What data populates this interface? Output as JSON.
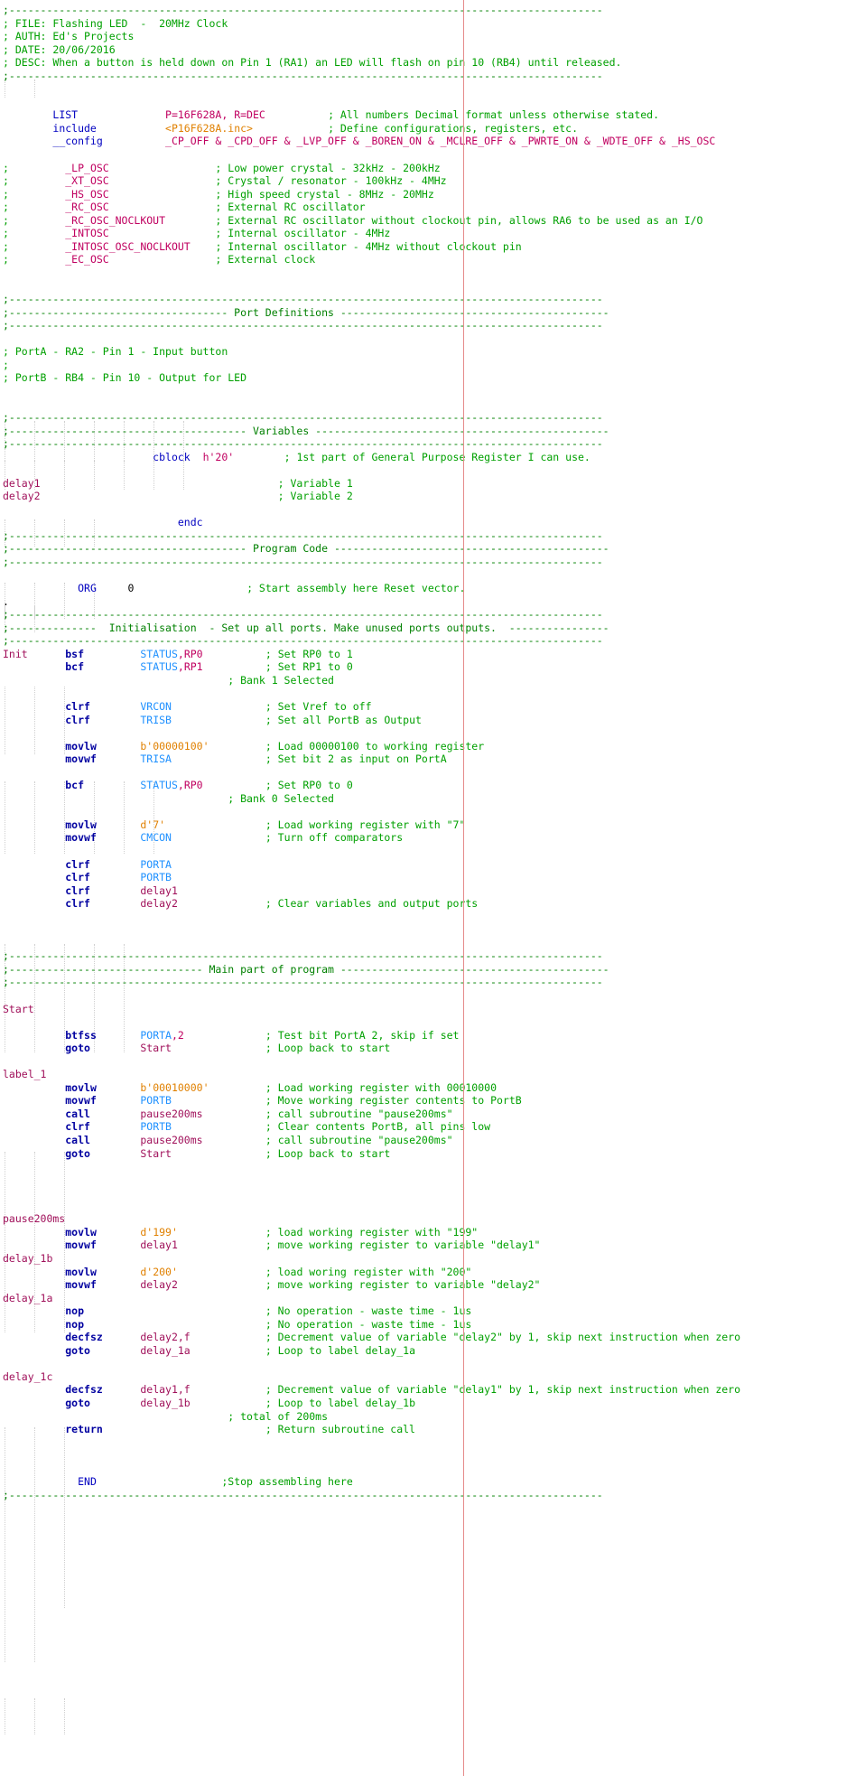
{
  "document": {
    "kind": "assembly-source",
    "language": "PIC Assembly (MPASM)",
    "file_header": {
      "file": "; FILE: Flashing LED  -  20MHz Clock",
      "auth": "; AUTH: Ed's Projects",
      "date": "; DATE: 20/06/2016",
      "desc": "; DESC: When a button is held down on Pin 1 (RA1) an LED will flash on pin 10 (RB4) until released."
    },
    "colors": {
      "background": "#ffffff",
      "comment": "#00a000",
      "directive": "#0000c0",
      "mnemonic": "#0000a0",
      "register": "#1e90ff",
      "label": "#a0105a",
      "literal": "#e08000",
      "margin_guide": "#e58b8b",
      "indent_guide": "#cfcfcf"
    },
    "margin_guide_column_x": 513,
    "separators": {
      "plain": ";-----------------------------------------------------------------------------------------------",
      "port_definitions": ";----------------------------------- Port Definitions -----------------------------------",
      "variables": ";-------------------------------------- Variables ---------------------------------------",
      "program_code": ";-------------------------------------- Program Code ------------------------------------",
      "initialisation": ";-------------- Initialisation  - Set up all ports. Make unused ports outputs.  ------------",
      "main_part": ";------------------------------- Main part of program ------------------------------------"
    },
    "lines": [
      {
        "i": 0,
        "type": "sep",
        "text": ";-----------------------------------------------------------------------------------------------"
      },
      {
        "i": 1,
        "type": "comment",
        "text": "; FILE: Flashing LED  -  20MHz Clock"
      },
      {
        "i": 2,
        "type": "comment",
        "text": "; AUTH: Ed's Projects"
      },
      {
        "i": 3,
        "type": "comment",
        "text": "; DATE: 20/06/2016"
      },
      {
        "i": 4,
        "type": "comment",
        "text": "; DESC: When a button is held down on Pin 1 (RA1) an LED will flash on pin 10 (RB4) until released."
      },
      {
        "i": 5,
        "type": "sep",
        "text": ";-----------------------------------------------------------------------------------------------"
      },
      {
        "i": 6,
        "type": "blank",
        "text": ""
      },
      {
        "i": 7,
        "type": "blank",
        "text": ""
      },
      {
        "i": 8,
        "type": "code",
        "label": "",
        "mnemonic": "LIST",
        "operand": "P=16F628A, R=DEC",
        "comment": "; All numbers Decimal format unless otherwise stated."
      },
      {
        "i": 9,
        "type": "code",
        "label": "",
        "mnemonic": "include",
        "operand": "<P16F628A.inc>",
        "comment": "; Define configurations, registers, etc."
      },
      {
        "i": 10,
        "type": "code",
        "label": "",
        "mnemonic": "__config",
        "operand": "_CP_OFF & _CPD_OFF & _LVP_OFF & _BOREN_ON & _MCLRE_OFF & _PWRTE_ON & _WDTE_OFF & _HS_OSC",
        "comment": ""
      },
      {
        "i": 11,
        "type": "blank",
        "text": ""
      },
      {
        "i": 12,
        "type": "osc",
        "symbol": "_LP_OSC",
        "comment": "; Low power crystal - 32kHz - 200kHz"
      },
      {
        "i": 13,
        "type": "osc",
        "symbol": "_XT_OSC",
        "comment": "; Crystal / resonator - 100kHz - 4MHz"
      },
      {
        "i": 14,
        "type": "osc",
        "symbol": "_HS_OSC",
        "comment": "; High speed crystal - 8MHz - 20MHz"
      },
      {
        "i": 15,
        "type": "osc",
        "symbol": "_RC_OSC",
        "comment": "; External RC oscillator"
      },
      {
        "i": 16,
        "type": "osc",
        "symbol": "_RC_OSC_NOCLKOUT",
        "comment": "; External RC oscillator without clockout pin, allows RA6 to be used as an I/O"
      },
      {
        "i": 17,
        "type": "osc",
        "symbol": "_INTOSC",
        "comment": "; Internal oscillator - 4MHz"
      },
      {
        "i": 18,
        "type": "osc",
        "symbol": "_INTOSC_OSC_NOCLKOUT",
        "comment": "; Internal oscillator - 4MHz without clockout pin"
      },
      {
        "i": 19,
        "type": "osc",
        "symbol": "_EC_OSC",
        "comment": "; External clock"
      },
      {
        "i": 20,
        "type": "blank",
        "text": ""
      },
      {
        "i": 21,
        "type": "blank",
        "text": ""
      },
      {
        "i": 22,
        "type": "sep",
        "text": ";-----------------------------------------------------------------------------------------------"
      },
      {
        "i": 23,
        "type": "sep",
        "text": ";----------------------------------- Port Definitions -------------------------------------------"
      },
      {
        "i": 24,
        "type": "sep",
        "text": ";-----------------------------------------------------------------------------------------------"
      },
      {
        "i": 25,
        "type": "blank",
        "text": ""
      },
      {
        "i": 26,
        "type": "comment",
        "text": "; PortA - RA2 - Pin 1 - Input button"
      },
      {
        "i": 27,
        "type": "comment",
        "text": ";"
      },
      {
        "i": 28,
        "type": "comment",
        "text": "; PortB - RB4 - Pin 10 - Output for LED"
      },
      {
        "i": 29,
        "type": "blank",
        "text": ""
      },
      {
        "i": 30,
        "type": "blank",
        "text": ""
      },
      {
        "i": 31,
        "type": "sep",
        "text": ";-----------------------------------------------------------------------------------------------"
      },
      {
        "i": 32,
        "type": "sep",
        "text": ";-------------------------------------- Variables -----------------------------------------------"
      },
      {
        "i": 33,
        "type": "sep",
        "text": ";-----------------------------------------------------------------------------------------------"
      },
      {
        "i": 34,
        "type": "cblock",
        "mnemonic": "cblock",
        "operand": "h'20'",
        "comment": "; 1st part of General Purpose Register I can use."
      },
      {
        "i": 35,
        "type": "blank",
        "text": ""
      },
      {
        "i": 36,
        "type": "var",
        "name": "delay1",
        "comment": "; Variable 1"
      },
      {
        "i": 37,
        "type": "var",
        "name": "delay2",
        "comment": "; Variable 2"
      },
      {
        "i": 38,
        "type": "blank",
        "text": ""
      },
      {
        "i": 39,
        "type": "endc",
        "mnemonic": "endc"
      },
      {
        "i": 40,
        "type": "sep",
        "text": ";-----------------------------------------------------------------------------------------------"
      },
      {
        "i": 41,
        "type": "sep",
        "text": ";-------------------------------------- Program Code --------------------------------------------"
      },
      {
        "i": 42,
        "type": "sep",
        "text": ";-----------------------------------------------------------------------------------------------"
      },
      {
        "i": 43,
        "type": "blank",
        "text": ""
      },
      {
        "i": 44,
        "type": "org",
        "mnemonic": "ORG",
        "operand": "0",
        "comment": "; Start assembly here Reset vector."
      },
      {
        "i": 45,
        "type": "dot",
        "text": "."
      },
      {
        "i": 46,
        "type": "sep",
        "text": ";-----------------------------------------------------------------------------------------------"
      },
      {
        "i": 47,
        "type": "sep",
        "text": ";--------------  Initialisation  - Set up all ports. Make unused ports outputs.  ----------------"
      },
      {
        "i": 48,
        "type": "sep",
        "text": ";-----------------------------------------------------------------------------------------------"
      },
      {
        "i": 49,
        "type": "instr",
        "label": "Init",
        "mnemonic": "bsf",
        "op1": "STATUS",
        "op2": ",RP0",
        "comment": "; Set RP0 to 1"
      },
      {
        "i": 50,
        "type": "instr",
        "label": "",
        "mnemonic": "bcf",
        "op1": "STATUS",
        "op2": ",RP1",
        "comment": "; Set RP1 to 0"
      },
      {
        "i": 51,
        "type": "commentonly",
        "comment": "; Bank 1 Selected"
      },
      {
        "i": 52,
        "type": "blank",
        "text": ""
      },
      {
        "i": 53,
        "type": "instr",
        "label": "",
        "mnemonic": "clrf",
        "op1": "VRCON",
        "op2": "",
        "comment": "; Set Vref to off"
      },
      {
        "i": 54,
        "type": "instr",
        "label": "",
        "mnemonic": "clrf",
        "op1": "TRISB",
        "op2": "",
        "comment": "; Set all PortB as Output"
      },
      {
        "i": 55,
        "type": "blank",
        "text": ""
      },
      {
        "i": 56,
        "type": "instr_lit",
        "label": "",
        "mnemonic": "movlw",
        "lit": "b'00000100'",
        "comment": "; Load 00000100 to working register"
      },
      {
        "i": 57,
        "type": "instr",
        "label": "",
        "mnemonic": "movwf",
        "op1": "TRISA",
        "op2": "",
        "comment": "; Set bit 2 as input on PortA"
      },
      {
        "i": 58,
        "type": "blank",
        "text": ""
      },
      {
        "i": 59,
        "type": "instr",
        "label": "",
        "mnemonic": "bcf",
        "op1": "STATUS",
        "op2": ",RP0",
        "comment": "; Set RP0 to 0"
      },
      {
        "i": 60,
        "type": "commentonly",
        "comment": "; Bank 0 Selected"
      },
      {
        "i": 61,
        "type": "blank",
        "text": ""
      },
      {
        "i": 62,
        "type": "instr_lit",
        "label": "",
        "mnemonic": "movlw",
        "lit": "d'7'",
        "comment": "; Load working register with \"7\""
      },
      {
        "i": 63,
        "type": "instr",
        "label": "",
        "mnemonic": "movwf",
        "op1": "CMCON",
        "op2": "",
        "comment": "; Turn off comparators"
      },
      {
        "i": 64,
        "type": "blank",
        "text": ""
      },
      {
        "i": 65,
        "type": "instr",
        "label": "",
        "mnemonic": "clrf",
        "op1": "PORTA",
        "op2": "",
        "comment": ""
      },
      {
        "i": 66,
        "type": "instr",
        "label": "",
        "mnemonic": "clrf",
        "op1": "PORTB",
        "op2": "",
        "comment": ""
      },
      {
        "i": 67,
        "type": "instr_var",
        "label": "",
        "mnemonic": "clrf",
        "var": "delay1",
        "comment": ""
      },
      {
        "i": 68,
        "type": "instr_var",
        "label": "",
        "mnemonic": "clrf",
        "var": "delay2",
        "comment": "; Clear variables and output ports"
      },
      {
        "i": 69,
        "type": "blank",
        "text": ""
      },
      {
        "i": 70,
        "type": "blank",
        "text": ""
      },
      {
        "i": 71,
        "type": "blank",
        "text": ""
      },
      {
        "i": 72,
        "type": "sep",
        "text": ";-----------------------------------------------------------------------------------------------"
      },
      {
        "i": 73,
        "type": "sep",
        "text": ";------------------------------- Main part of program -------------------------------------------"
      },
      {
        "i": 74,
        "type": "sep",
        "text": ";-----------------------------------------------------------------------------------------------"
      },
      {
        "i": 75,
        "type": "blank",
        "text": ""
      },
      {
        "i": 76,
        "type": "labelonly",
        "label": "Start"
      },
      {
        "i": 77,
        "type": "blank",
        "text": ""
      },
      {
        "i": 78,
        "type": "instr",
        "label": "",
        "mnemonic": "btfss",
        "op1": "PORTA",
        "op2": ",2",
        "comment": "; Test bit PortA 2, skip if set"
      },
      {
        "i": 79,
        "type": "goto",
        "label": "",
        "mnemonic": "goto",
        "target": "Start",
        "comment": "; Loop back to start"
      },
      {
        "i": 80,
        "type": "blank",
        "text": ""
      },
      {
        "i": 81,
        "type": "labelonly",
        "label": "label_1"
      },
      {
        "i": 82,
        "type": "instr_lit",
        "label": "",
        "mnemonic": "movlw",
        "lit": "b'00010000'",
        "comment": "; Load working register with 00010000"
      },
      {
        "i": 83,
        "type": "instr",
        "label": "",
        "mnemonic": "movwf",
        "op1": "PORTB",
        "op2": "",
        "comment": "; Move working register contents to PortB"
      },
      {
        "i": 84,
        "type": "goto",
        "label": "",
        "mnemonic": "call",
        "target": "pause200ms",
        "comment": "; call subroutine \"pause200ms\""
      },
      {
        "i": 85,
        "type": "instr",
        "label": "",
        "mnemonic": "clrf",
        "op1": "PORTB",
        "op2": "",
        "comment": "; Clear contents PortB, all pins low"
      },
      {
        "i": 86,
        "type": "goto",
        "label": "",
        "mnemonic": "call",
        "target": "pause200ms",
        "comment": "; call subroutine \"pause200ms\""
      },
      {
        "i": 87,
        "type": "goto",
        "label": "",
        "mnemonic": "goto",
        "target": "Start",
        "comment": "; Loop back to start"
      },
      {
        "i": 88,
        "type": "blank",
        "text": ""
      },
      {
        "i": 89,
        "type": "blank",
        "text": ""
      },
      {
        "i": 90,
        "type": "blank",
        "text": ""
      },
      {
        "i": 91,
        "type": "blank",
        "text": ""
      },
      {
        "i": 92,
        "type": "labelonly",
        "label": "pause200ms"
      },
      {
        "i": 93,
        "type": "instr_lit",
        "label": "",
        "mnemonic": "movlw",
        "lit": "d'199'",
        "comment": "; load working register with \"199\""
      },
      {
        "i": 94,
        "type": "instr_var",
        "label": "",
        "mnemonic": "movwf",
        "var": "delay1",
        "comment": "; move working register to variable \"delay1\""
      },
      {
        "i": 95,
        "type": "labelonly",
        "label": "delay_1b"
      },
      {
        "i": 96,
        "type": "instr_lit",
        "label": "",
        "mnemonic": "movlw",
        "lit": "d'200'",
        "comment": "; load woring register with \"200\""
      },
      {
        "i": 97,
        "type": "instr_var",
        "label": "",
        "mnemonic": "movwf",
        "var": "delay2",
        "comment": "; move working register to variable \"delay2\""
      },
      {
        "i": 98,
        "type": "labelonly",
        "label": "delay_1a"
      },
      {
        "i": 99,
        "type": "instr_plain",
        "label": "",
        "mnemonic": "nop",
        "comment": "; No operation - waste time - 1us"
      },
      {
        "i": 100,
        "type": "instr_plain",
        "label": "",
        "mnemonic": "nop",
        "comment": "; No operation - waste time - 1us"
      },
      {
        "i": 101,
        "type": "instr_var",
        "label": "",
        "mnemonic": "decfsz",
        "var": "delay2,f",
        "comment": "; Decrement value of variable \"delay2\" by 1, skip next instruction when zero"
      },
      {
        "i": 102,
        "type": "goto",
        "label": "",
        "mnemonic": "goto",
        "target": "delay_1a",
        "comment": "; Loop to label delay_1a"
      },
      {
        "i": 103,
        "type": "blank",
        "text": ""
      },
      {
        "i": 104,
        "type": "labelonly",
        "label": "delay_1c"
      },
      {
        "i": 105,
        "type": "instr_var",
        "label": "",
        "mnemonic": "decfsz",
        "var": "delay1,f",
        "comment": "; Decrement value of variable \"delay1\" by 1, skip next instruction when zero"
      },
      {
        "i": 106,
        "type": "goto",
        "label": "",
        "mnemonic": "goto",
        "target": "delay_1b",
        "comment": "; Loop to label delay_1b"
      },
      {
        "i": 107,
        "type": "commentonly",
        "comment": "; total of 200ms"
      },
      {
        "i": 108,
        "type": "instr_plain",
        "label": "",
        "mnemonic": "return",
        "comment": "; Return subroutine call"
      },
      {
        "i": 109,
        "type": "blank",
        "text": ""
      },
      {
        "i": 110,
        "type": "blank",
        "text": ""
      },
      {
        "i": 111,
        "type": "blank",
        "text": ""
      },
      {
        "i": 112,
        "type": "end",
        "mnemonic": "END",
        "comment": ";Stop assembling here"
      },
      {
        "i": 113,
        "type": "sep",
        "text": ";-----------------------------------------------------------------------------------------------"
      }
    ]
  }
}
